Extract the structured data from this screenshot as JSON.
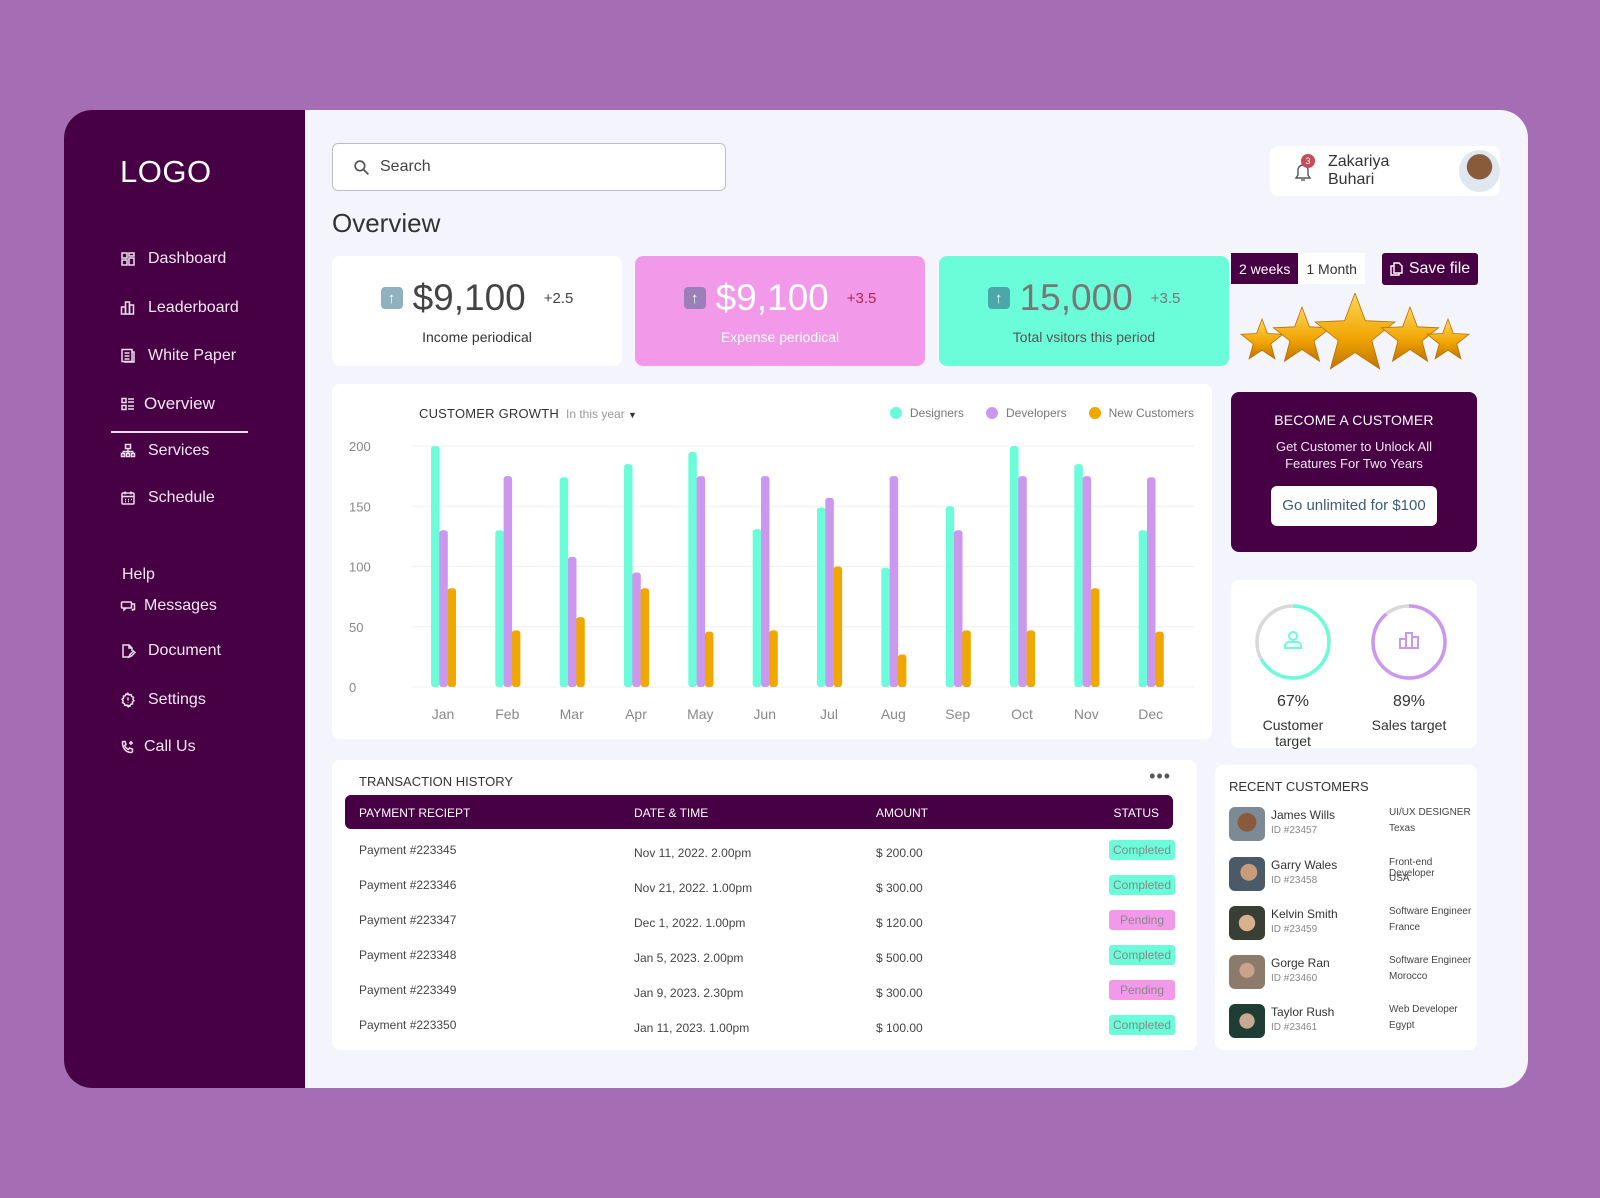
{
  "sidebar": {
    "logo": "LOGO",
    "items": [
      {
        "label": "Dashboard",
        "icon": "dashboard-icon"
      },
      {
        "label": "Leaderboard",
        "icon": "leaderboard-icon"
      },
      {
        "label": "White Paper",
        "icon": "document-icon"
      },
      {
        "label": "Overview",
        "icon": "list-grid-icon",
        "active": true
      },
      {
        "label": "Services",
        "icon": "hierarchy-icon"
      },
      {
        "label": "Schedule",
        "icon": "calendar-icon"
      }
    ],
    "help_label": "Help",
    "help_items": [
      {
        "label": "Messages",
        "icon": "chat-icon"
      },
      {
        "label": "Document",
        "icon": "file-edit-icon"
      },
      {
        "label": "Settings",
        "icon": "gear-icon"
      },
      {
        "label": "Call Us",
        "icon": "phone-icon"
      }
    ]
  },
  "header": {
    "search_placeholder": "Search",
    "search_value": "",
    "user_name": "Zakariya Buhari",
    "notification_count": "3"
  },
  "page_title": "Overview",
  "stats": [
    {
      "value": "$9,100",
      "delta": "+2.5",
      "label": "Income periodical",
      "bg": "#ffffff",
      "arrow_bg": "#8fb1c0"
    },
    {
      "value": "$9,100",
      "delta": "+3.5",
      "label": "Expense periodical",
      "bg": "#f29ae9",
      "arrow_bg": "#9a7fb8"
    },
    {
      "value": "15,000",
      "delta": "+3.5",
      "label": "Total vsitors this period",
      "bg": "#6bfcd9",
      "arrow_bg": "#4aa8a8"
    }
  ],
  "period": {
    "options": [
      "2 weeks",
      "1 Month"
    ],
    "selected": "2 weeks",
    "save_label": "Save file"
  },
  "rating": {
    "stars": 5,
    "max": 5
  },
  "chart_data": {
    "type": "bar",
    "title": "CUSTOMER GROWTH",
    "filter": "In this year",
    "categories": [
      "Jan",
      "Feb",
      "Mar",
      "Apr",
      "May",
      "Jun",
      "Jul",
      "Aug",
      "Sep",
      "Oct",
      "Nov",
      "Dec"
    ],
    "series": [
      {
        "name": "Designers",
        "color": "#6bfcd9",
        "values": [
          200,
          130,
          174,
          185,
          195,
          131,
          149,
          99,
          150,
          200,
          185,
          130
        ]
      },
      {
        "name": "Developers",
        "color": "#cc98ef",
        "values": [
          130,
          175,
          108,
          95,
          175,
          175,
          157,
          175,
          130,
          175,
          175,
          174
        ]
      },
      {
        "name": "New Customers",
        "color": "#f0a800",
        "values": [
          82,
          47,
          58,
          82,
          46,
          47,
          100,
          27,
          47,
          47,
          82,
          46
        ]
      }
    ],
    "yticks": [
      0,
      50,
      100,
      150,
      200
    ],
    "ylim": [
      0,
      200
    ],
    "xlabel": "",
    "ylabel": "",
    "grid": true,
    "legend": "top-right"
  },
  "promo": {
    "title": "BECOME A CUSTOMER",
    "text": "Get Customer to Unlock All Features For Two Years",
    "button": "Go unlimited for $100"
  },
  "targets": [
    {
      "percent": 67,
      "label_pct": "67%",
      "label": "Customer target",
      "color": "#6bfcd9",
      "icon": "user-icon"
    },
    {
      "percent": 89,
      "label_pct": "89%",
      "label": "Sales target",
      "color": "#cc98ef",
      "icon": "bar-chart-icon"
    }
  ],
  "transactions": {
    "title": "TRANSACTION HISTORY",
    "columns": [
      "PAYMENT RECIEPT",
      "DATE & TIME",
      "AMOUNT",
      "STATUS"
    ],
    "rows": [
      {
        "receipt": "Payment  #223345",
        "date": "Nov 11, 2022. 2.00pm",
        "amount": "$ 200.00",
        "status": "Completed"
      },
      {
        "receipt": "Payment  #223346",
        "date": "Nov 21, 2022. 1.00pm",
        "amount": "$ 300.00",
        "status": "Completed"
      },
      {
        "receipt": "Payment  #223347",
        "date": "Dec 1, 2022. 1.00pm",
        "amount": "$ 120.00",
        "status": "Pending"
      },
      {
        "receipt": "Payment  #223348",
        "date": "Jan 5, 2023. 2.00pm",
        "amount": "$ 500.00",
        "status": "Completed"
      },
      {
        "receipt": "Payment  #223349",
        "date": "Jan 9, 2023. 2.30pm",
        "amount": "$ 300.00",
        "status": "Pending"
      },
      {
        "receipt": "Payment  #223350",
        "date": "Jan 11, 2023. 1.00pm",
        "amount": "$ 100.00",
        "status": "Completed"
      }
    ],
    "status_colors": {
      "Completed": "#6bfcd9",
      "Pending": "#f29ae9"
    }
  },
  "recent_customers": {
    "title": "RECENT CUSTOMERS",
    "items": [
      {
        "name": "James Wills",
        "id": "ID #23457",
        "role": "UI/UX DESIGNER",
        "location": "Texas"
      },
      {
        "name": "Garry Wales",
        "id": "ID #23458",
        "role": "Front-end Developer",
        "location": "USA"
      },
      {
        "name": "Kelvin Smith",
        "id": "ID #23459",
        "role": "Software Engineer",
        "location": "France"
      },
      {
        "name": "Gorge Ran",
        "id": "ID #23460",
        "role": "Software Engineer",
        "location": "Morocco"
      },
      {
        "name": "Taylor Rush",
        "id": "ID #23461",
        "role": "Web Developer",
        "location": "Egypt"
      }
    ]
  }
}
